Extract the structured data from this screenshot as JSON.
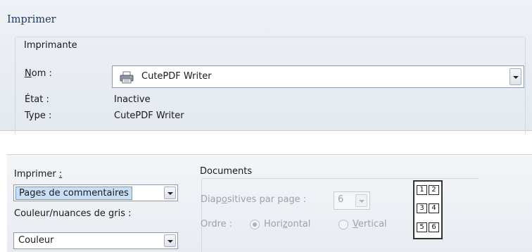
{
  "dialog": {
    "title": "Imprimer"
  },
  "printer_group": {
    "legend": "Imprimante",
    "name_label_u": "N",
    "name_label_rest": "om :",
    "name_value": "CutePDF Writer",
    "state_label": "État :",
    "state_value": "Inactive",
    "type_label": "Type :",
    "type_value": "CutePDF Writer"
  },
  "print_section": {
    "print_label": "Imprimer ",
    "print_label_u": ":",
    "print_value": "Pages de commentaires",
    "color_label_pre": "Couleur/nuances de ",
    "color_label_u": "g",
    "color_label_post": "ris :",
    "color_value": "Couleur"
  },
  "documents": {
    "legend": "Documents",
    "slides_label_pre": "Diap",
    "slides_label_u": "o",
    "slides_label_post": "sitives par page :",
    "slides_value": "6",
    "order_label": "Ordre :",
    "horizontal_pre": "Hori",
    "horizontal_u": "z",
    "horizontal_post": "ontal",
    "vertical_u": "V",
    "vertical_post": "ertical",
    "preview_slots": [
      "1",
      "2",
      "3",
      "4",
      "5",
      "6"
    ]
  }
}
